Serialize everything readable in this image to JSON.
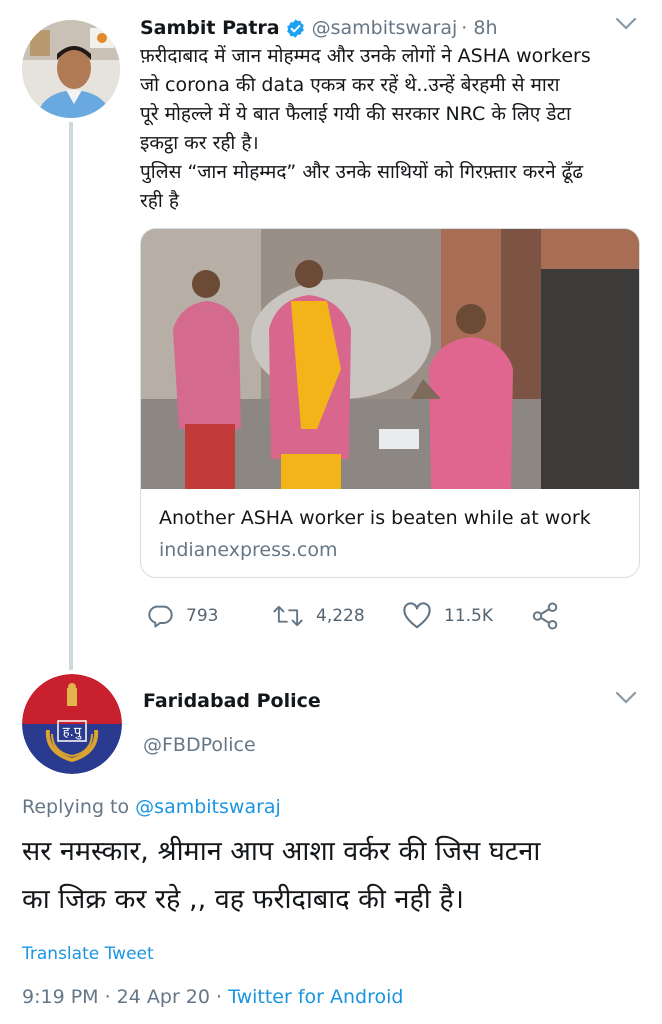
{
  "tweet": {
    "author_name": "Sambit Patra",
    "author_handle": "@sambitswaraj",
    "time": "· 8h",
    "text_lines": [
      "फ़रीदाबाद में जान मोहम्मद और उनके लोगों ने ASHA workers",
      "जो corona की data एकत्र कर रहें थे..उन्हें बेरहमी से मारा",
      "पूरे मोहल्ले में ये बात फैलाई गयी की सरकार NRC के लिए डेटा",
      "इकट्ठा कर रही है।",
      "पुलिस “जान मोहम्मद” और उनके साथियों को गिरफ़्तार करने ढूँढ",
      "रही है"
    ],
    "link_card": {
      "title": "Another ASHA worker is beaten while at work",
      "domain": "indianexpress.com"
    },
    "stats": {
      "replies": "793",
      "retweets": "4,228",
      "likes": "11.5K"
    }
  },
  "reply": {
    "author_name": "Faridabad Police",
    "author_handle": "@FBDPolice",
    "replying_prefix": "Replying to",
    "replying_to": "@sambitswaraj",
    "text_lines": [
      "सर नमस्कार, श्रीमान आप आशा वर्कर की जिस घटना",
      "का जिक्र कर रहे ,, वह फरीदाबाद की नही है।"
    ],
    "translate_label": "Translate Tweet",
    "timestamp": "9:19 PM · 24 Apr 20 · ",
    "source": "Twitter for Android",
    "badge_text": "ह.पु"
  },
  "colors": {
    "link_blue": "#1b95e0",
    "muted_gray": "#657786",
    "police_red": "#c8202f",
    "police_blue": "#2a3a8f"
  }
}
